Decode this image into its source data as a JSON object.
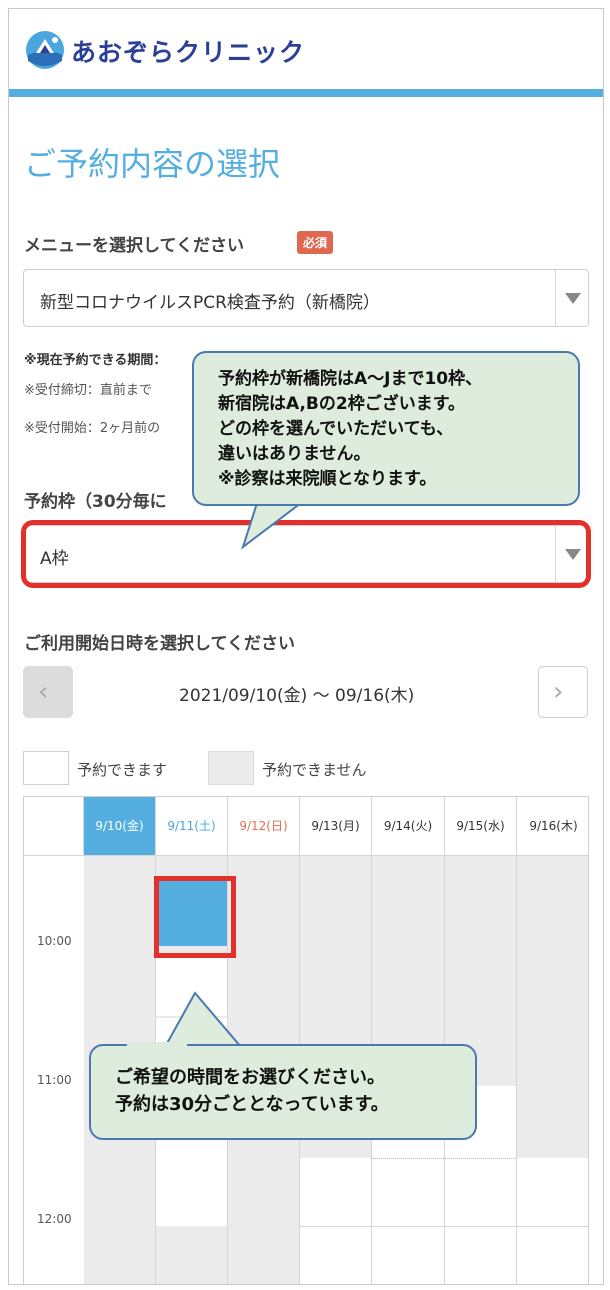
{
  "header": {
    "app_name": "あおぞらクリニック"
  },
  "page_title": "ご予約内容の選択",
  "menu": {
    "label": "メニューを選択してください",
    "required_badge": "必須",
    "selected_value": "新型コロナウイルスPCR検査予約（新橋院）"
  },
  "notes": {
    "period": "※現在予約できる期間：",
    "deadline": "※受付締切：直前まで",
    "start": "※受付開始：2ヶ月前の"
  },
  "slot_frame": {
    "label": "予約枠（30分毎に",
    "selected_value": "A枠"
  },
  "callout_top": {
    "line1": "予約枠が新橋院はA〜Jまで10枠、",
    "line2": "新宿院はA,Bの2枠ございます。",
    "line3": "どの枠を選んでいただいても、",
    "line4": "違いはありません。",
    "line5": "※診察は来院順となります。"
  },
  "calendar": {
    "label": "ご利用開始日時を選択してください",
    "week_range": "2021/09/10(金) 〜 09/16(木)",
    "legend_available": "予約できます",
    "legend_unavailable": "予約できません",
    "days": [
      "9/10(金)",
      "9/11(土)",
      "9/12(日)",
      "9/13(月)",
      "9/14(火)",
      "9/15(水)",
      "9/16(木)"
    ],
    "times": [
      "10:00",
      "11:00",
      "12:00"
    ]
  },
  "callout_bottom": {
    "line1": "ご希望の時間をお選びください。",
    "line2": "予約は30分ごととなっています。"
  },
  "colors": {
    "accent": "#55aee0",
    "brand": "#2a3f96",
    "highlight": "#e3302a",
    "required": "#e06750",
    "callout_bg": "#ddecdc",
    "callout_border": "#4a7ab0"
  }
}
